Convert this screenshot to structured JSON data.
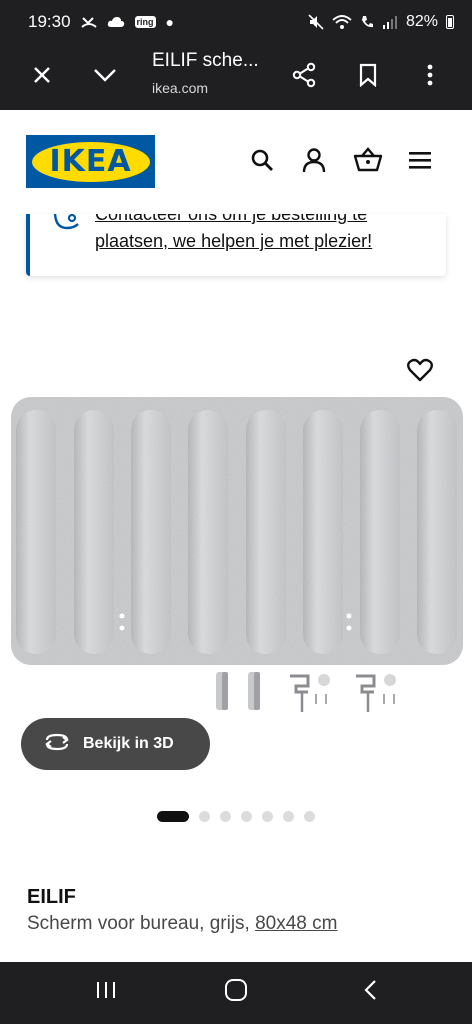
{
  "status_bar": {
    "time": "19:30",
    "ring_label": "ring",
    "battery": "82%"
  },
  "browser": {
    "title": "EILIF sche...",
    "url": "ikea.com"
  },
  "header": {
    "logo_text": "IKEA"
  },
  "contact": {
    "line1": "Contacteer ons om je bestelling te",
    "line2": "plaatsen, we helpen je met plezier!"
  },
  "media": {
    "view_3d_label": "Bekijk in 3D",
    "image_count": 7,
    "active_index": 0
  },
  "product": {
    "name": "EILIF",
    "description": "Scherm voor bureau, grijs, ",
    "size": "80x48 cm"
  },
  "colors": {
    "ikea_blue": "#0058a3",
    "ikea_yellow": "#ffdb00",
    "system_bar": "#1f1f21",
    "felt_grey": "#c9cacc"
  }
}
